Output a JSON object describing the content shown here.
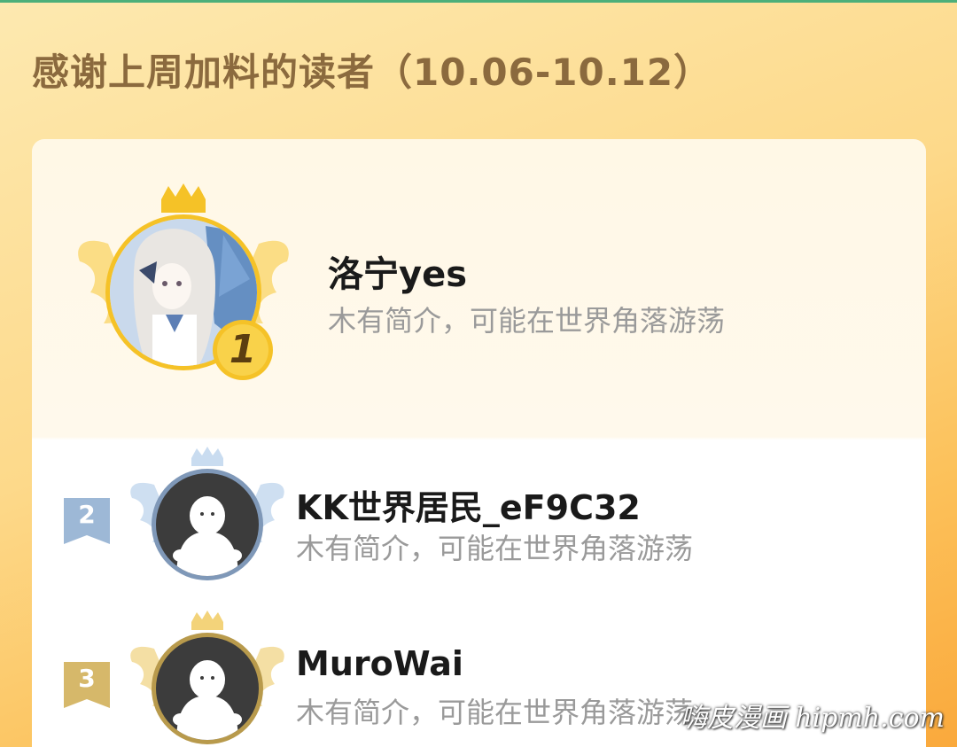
{
  "title": "感谢上周加料的读者（10.06-10.12）",
  "readers": [
    {
      "rank": "1",
      "name": "洛宁yes",
      "bio": "木有简介，可能在世界角落游荡"
    },
    {
      "rank": "2",
      "name": "KK世界居民_eF9C32",
      "bio": "木有简介，可能在世界角落游荡"
    },
    {
      "rank": "3",
      "name": "MuroWai",
      "bio": "木有简介，可能在世界角落游荡"
    }
  ],
  "watermark": "嗨皮漫画 hipmh.com",
  "colors": {
    "gold": "#f5c227",
    "silver": "#9db8d6",
    "bronze": "#d6b86a",
    "title": "#8b6a3e"
  },
  "icons": {
    "crown": "crown-icon",
    "wings": "wings-icon",
    "default_avatar": "default-avatar-icon"
  }
}
